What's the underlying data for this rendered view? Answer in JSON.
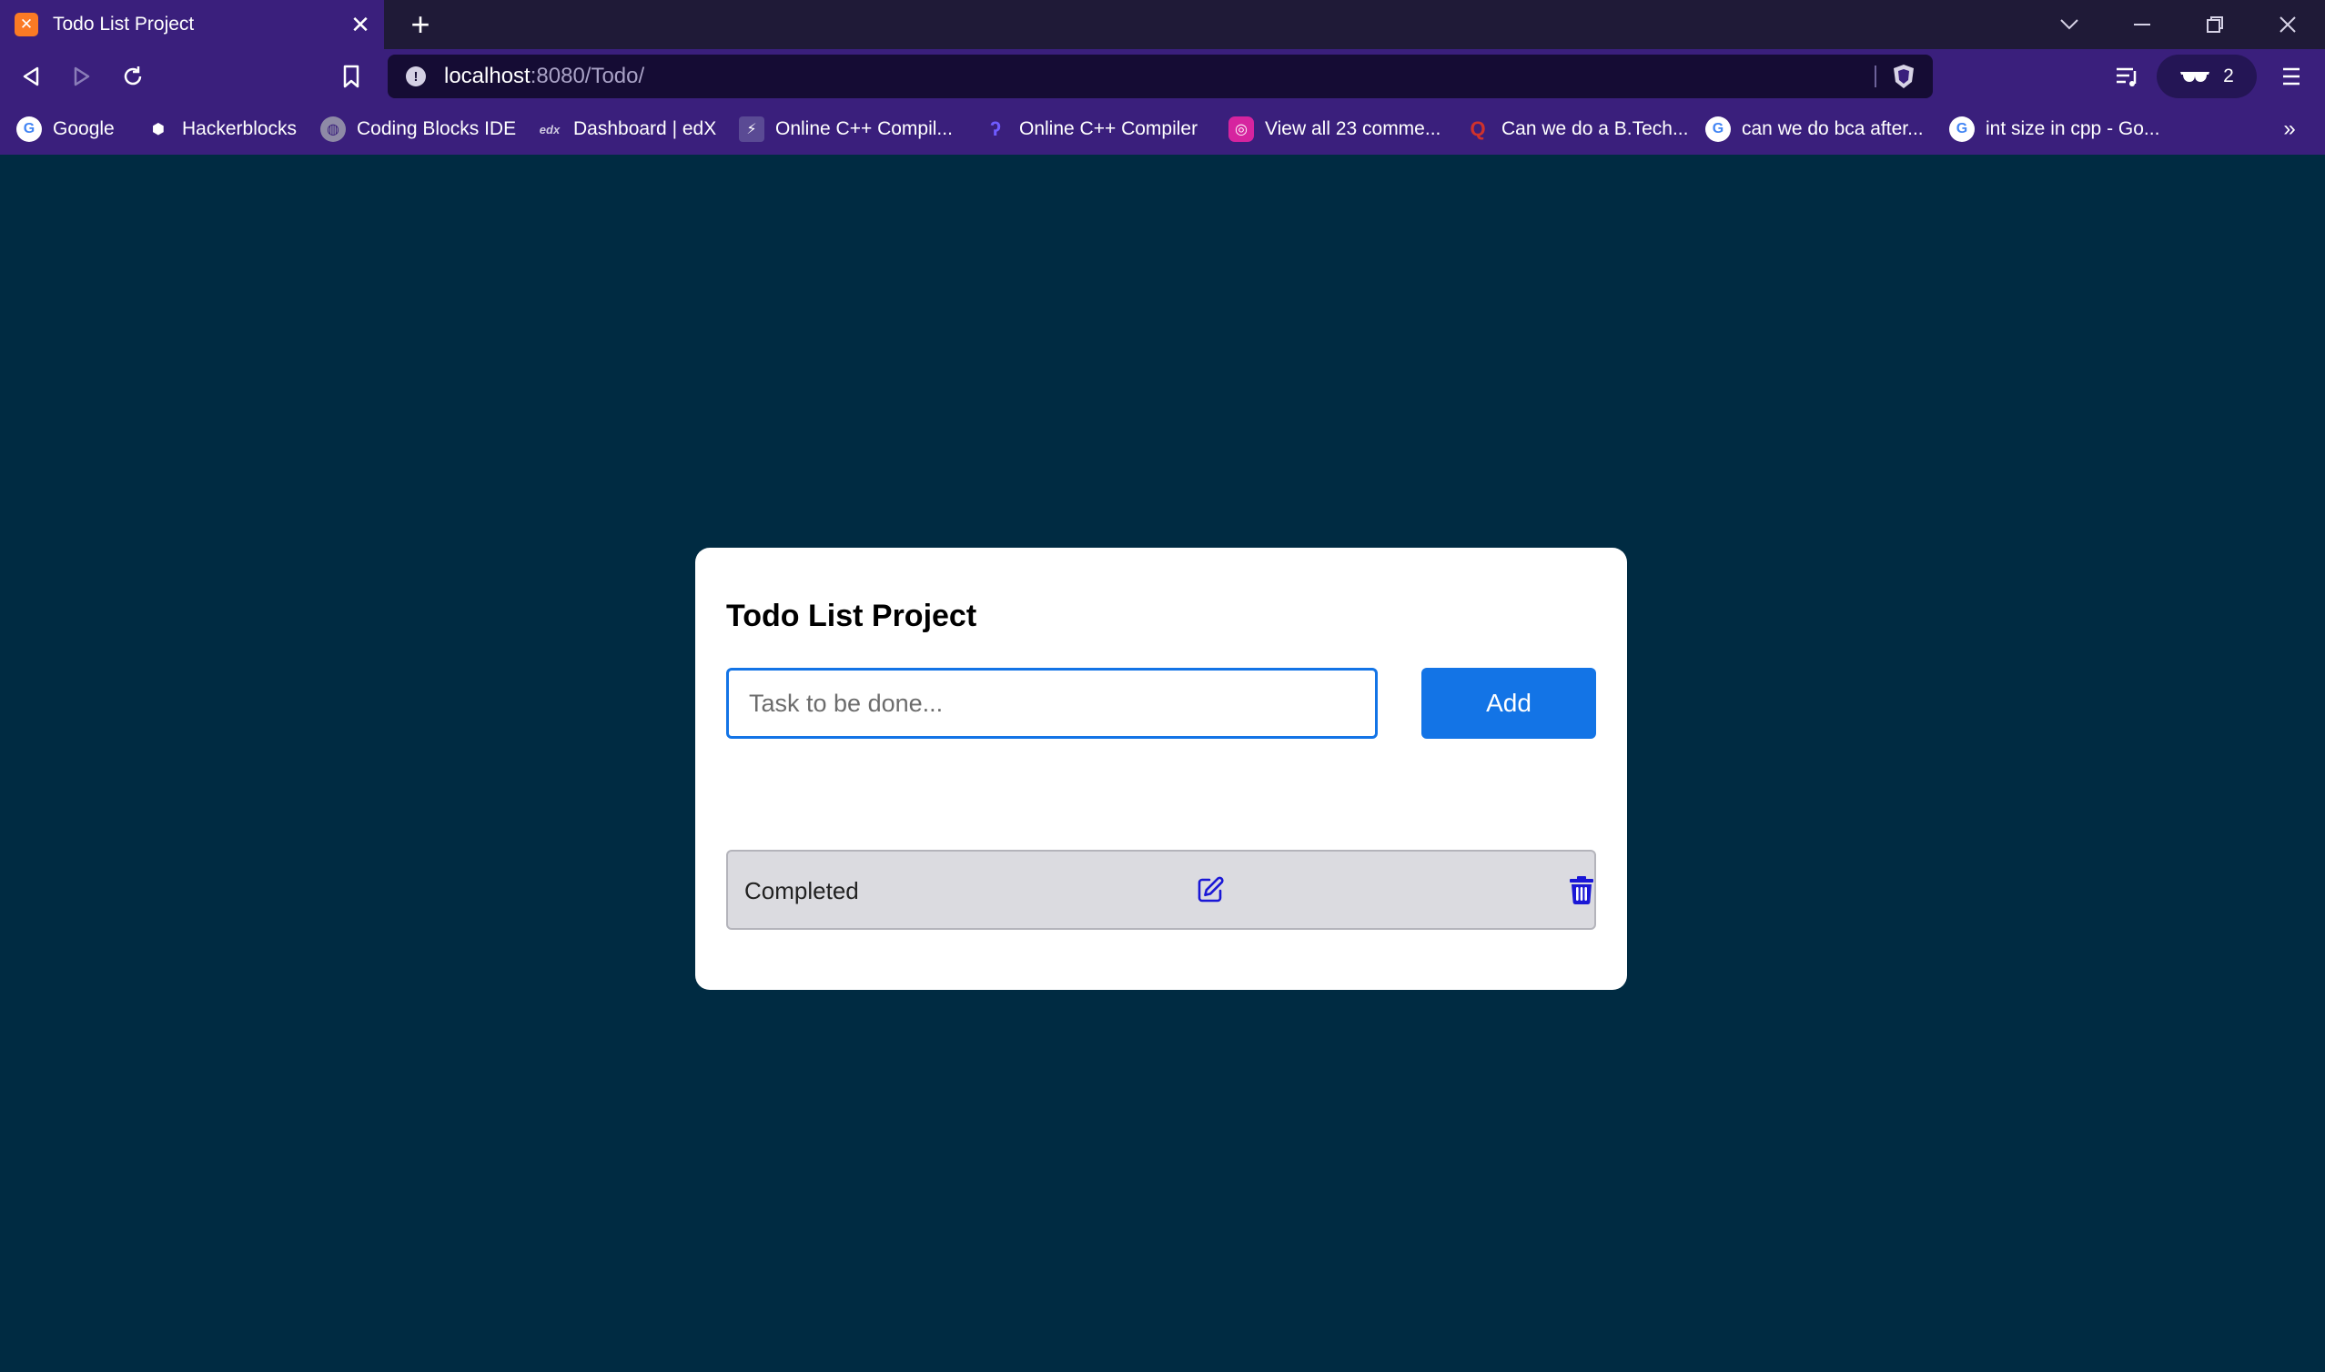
{
  "browser": {
    "tab": {
      "title": "Todo List Project",
      "favicon": "xampp-icon"
    },
    "address": {
      "host": "localhost",
      "path": ":8080/Todo/"
    },
    "wallet_count": "2",
    "bookmarks": [
      {
        "label": "Google",
        "icon": "google-icon"
      },
      {
        "label": "Hackerblocks",
        "icon": "hackerblocks-icon"
      },
      {
        "label": "Coding Blocks IDE",
        "icon": "globe-icon"
      },
      {
        "label": "Dashboard | edX",
        "icon": "edx-icon"
      },
      {
        "label": "Online C++ Compil...",
        "icon": "bolt-icon"
      },
      {
        "label": "Online C++ Compiler",
        "icon": "programiz-icon"
      },
      {
        "label": "View all 23 comme...",
        "icon": "instagram-icon"
      },
      {
        "label": "Can we do a B.Tech...",
        "icon": "quora-icon"
      },
      {
        "label": "can we do bca after...",
        "icon": "google-icon"
      },
      {
        "label": "int size in cpp - Go...",
        "icon": "google-icon"
      }
    ],
    "overflow_label": "»"
  },
  "app": {
    "title": "Todo List Project",
    "input": {
      "placeholder": "Task to be done...",
      "value": ""
    },
    "add_label": "Add",
    "todos": [
      {
        "text": "Completed"
      }
    ]
  },
  "colors": {
    "page_background": "#002b42",
    "accent": "#1374e6",
    "browser_chrome": "#3a1f7c",
    "todo_row": "#dbdbe0"
  }
}
